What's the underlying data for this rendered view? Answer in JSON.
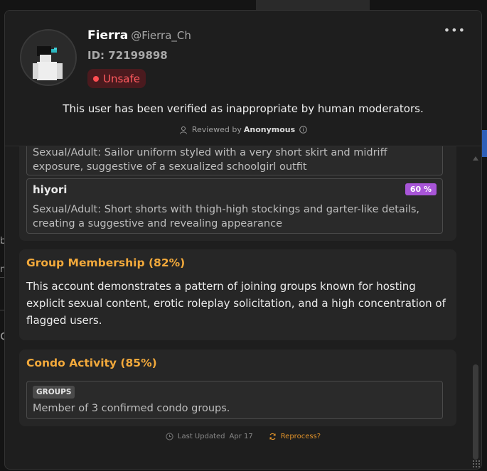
{
  "user": {
    "display_name": "Fierra",
    "username": "@Fierra_Ch",
    "id_text": "ID: 72199898",
    "status": "Unsafe"
  },
  "header": {
    "menu_label": "•••",
    "verified_text": "This user has been verified as inappropriate by human moderators.",
    "reviewed_prefix": "Reviewed by",
    "reviewed_by": "Anonymous"
  },
  "outfits": [
    {
      "name": "",
      "description": "Sexual/Adult: Sailor uniform styled with a very short skirt and midriff exposure, suggestive of a sexualized schoolgirl outfit"
    },
    {
      "name": "hiyori",
      "confidence": "60 %",
      "description": "Sexual/Adult: Short shorts with thigh-high stockings and garter-like details, creating a suggestive and revealing appearance"
    }
  ],
  "group_membership": {
    "title": "Group Membership (82%)",
    "body": "This account demonstrates a pattern of joining groups known for hosting explicit sexual content, erotic roleplay solicitation, and a high concentration of flagged users."
  },
  "condo_activity": {
    "title": "Condo Activity (85%)",
    "tag": "GROUPS",
    "text": "Member of 3 confirmed condo groups."
  },
  "footer": {
    "last_updated_label": "Last Updated",
    "last_updated_date": "Apr 17",
    "reprocess_label": "Reprocess?"
  },
  "colors": {
    "accent": "#f2a93b",
    "unsafe": "#ff5a5f",
    "confidence_badge": "#a855d8",
    "reprocess": "#e0922a"
  },
  "icons": [
    "ellipsis-icon",
    "user-icon",
    "info-icon",
    "clock-icon",
    "refresh-icon",
    "resize-grip-icon"
  ]
}
